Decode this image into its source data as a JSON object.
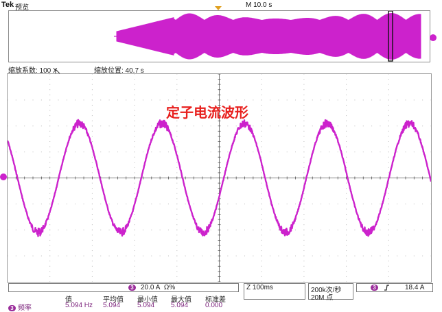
{
  "header": {
    "logo": "Tek",
    "mode": "预览",
    "timebase": "M 10.0 s"
  },
  "zoom": {
    "factor": "缩放系数: 100 X",
    "position": "缩放位置: 40.7 s"
  },
  "annotation": "定子电流波形",
  "channel": {
    "number": "3",
    "color": "#cc22cc",
    "scale": "20.0 A",
    "coupling": "Ω%"
  },
  "horizontal": {
    "timescale": "100ms",
    "samplerate": "200k次/秒",
    "record_length": "20M 点"
  },
  "trigger": {
    "channel": "3",
    "slope_icon": "rising-edge-icon",
    "level": "18.4 A"
  },
  "measurements": {
    "label": "频率",
    "headers": [
      "值",
      "平均值",
      "最小值",
      "最大值",
      "标准差"
    ],
    "values": [
      "5.094 Hz",
      "5.094",
      "5.094",
      "5.094",
      "0.000"
    ]
  },
  "waveform": {
    "cycles_visible": 5,
    "amplitude_divisions": 2.1
  },
  "overview": {
    "trace_start_fraction": 0.26,
    "zoom_window_fraction": 0.902
  }
}
